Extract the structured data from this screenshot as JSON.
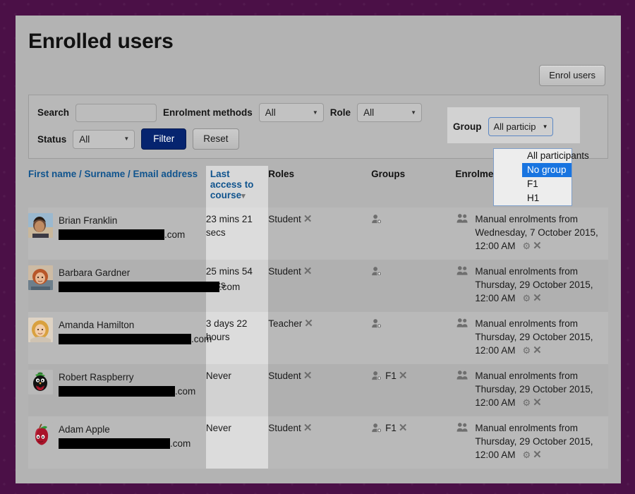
{
  "page": {
    "title": "Enrolled users"
  },
  "toolbar": {
    "enrol_users_label": "Enrol users"
  },
  "filters": {
    "search_label": "Search",
    "search_value": "",
    "search_placeholder": "",
    "enrolment_methods_label": "Enrolment methods",
    "enrolment_methods_value": "All",
    "role_label": "Role",
    "role_value": "All",
    "status_label": "Status",
    "status_value": "All",
    "filter_button": "Filter",
    "reset_button": "Reset",
    "filter_button_color": "#06246f"
  },
  "group_filter": {
    "label": "Group",
    "selected_value": "All particip",
    "options": [
      {
        "label": "All participants",
        "selected": false
      },
      {
        "label": "No group",
        "selected": true
      },
      {
        "label": "F1",
        "selected": false
      },
      {
        "label": "H1",
        "selected": false
      }
    ],
    "highlight_color": "#1874e0"
  },
  "table": {
    "headers": {
      "name": "First name / Surname / Email address",
      "last_access": "Last access to course",
      "roles": "Roles",
      "groups": "Groups",
      "enrolment_methods": "Enrolment methods"
    },
    "sort": {
      "column": "last_access",
      "direction": "desc"
    },
    "rows": [
      {
        "name": "Brian Franklin",
        "email_tld": ".com",
        "email_redact_width": 150,
        "avatar": "photo-man-blue",
        "last_access": "23 mins 21 secs",
        "role": "Student",
        "groups": [],
        "enrolment_method": "Manual enrolments from Wednesday, 7 October 2015, 12:00 AM"
      },
      {
        "name": "Barbara Gardner",
        "email_tld": ".com",
        "email_redact_width": 228,
        "avatar": "photo-woman-red",
        "last_access": "25 mins 54 secs",
        "role": "Student",
        "groups": [],
        "enrolment_method": "Manual enrolments from Thursday, 29 October 2015, 12:00 AM"
      },
      {
        "name": "Amanda Hamilton",
        "email_tld": ".com",
        "email_redact_width": 188,
        "avatar": "photo-woman-blonde",
        "last_access": "3 days 22 hours",
        "role": "Teacher",
        "groups": [],
        "enrolment_method": "Manual enrolments from Thursday, 29 October 2015, 12:00 AM"
      },
      {
        "name": "Robert Raspberry",
        "email_tld": ".com",
        "email_redact_width": 165,
        "avatar": "raspberry-penguin",
        "last_access": "Never",
        "role": "Student",
        "groups": [
          "F1"
        ],
        "enrolment_method": "Manual enrolments from Thursday, 29 October 2015, 12:00 AM"
      },
      {
        "name": "Adam Apple",
        "email_tld": ".com",
        "email_redact_width": 158,
        "avatar": "red-apple",
        "last_access": "Never",
        "role": "Student",
        "groups": [
          "F1"
        ],
        "enrolment_method": "Manual enrolments from Thursday, 29 October 2015, 12:00 AM"
      }
    ]
  },
  "icons": {
    "sort_desc": "▾",
    "delete": "✕",
    "gear": "⚙",
    "caret_down": "▼"
  },
  "colors": {
    "site_background": "#4b1047",
    "page_background": "#b3b3b3",
    "link": "#10548e"
  }
}
